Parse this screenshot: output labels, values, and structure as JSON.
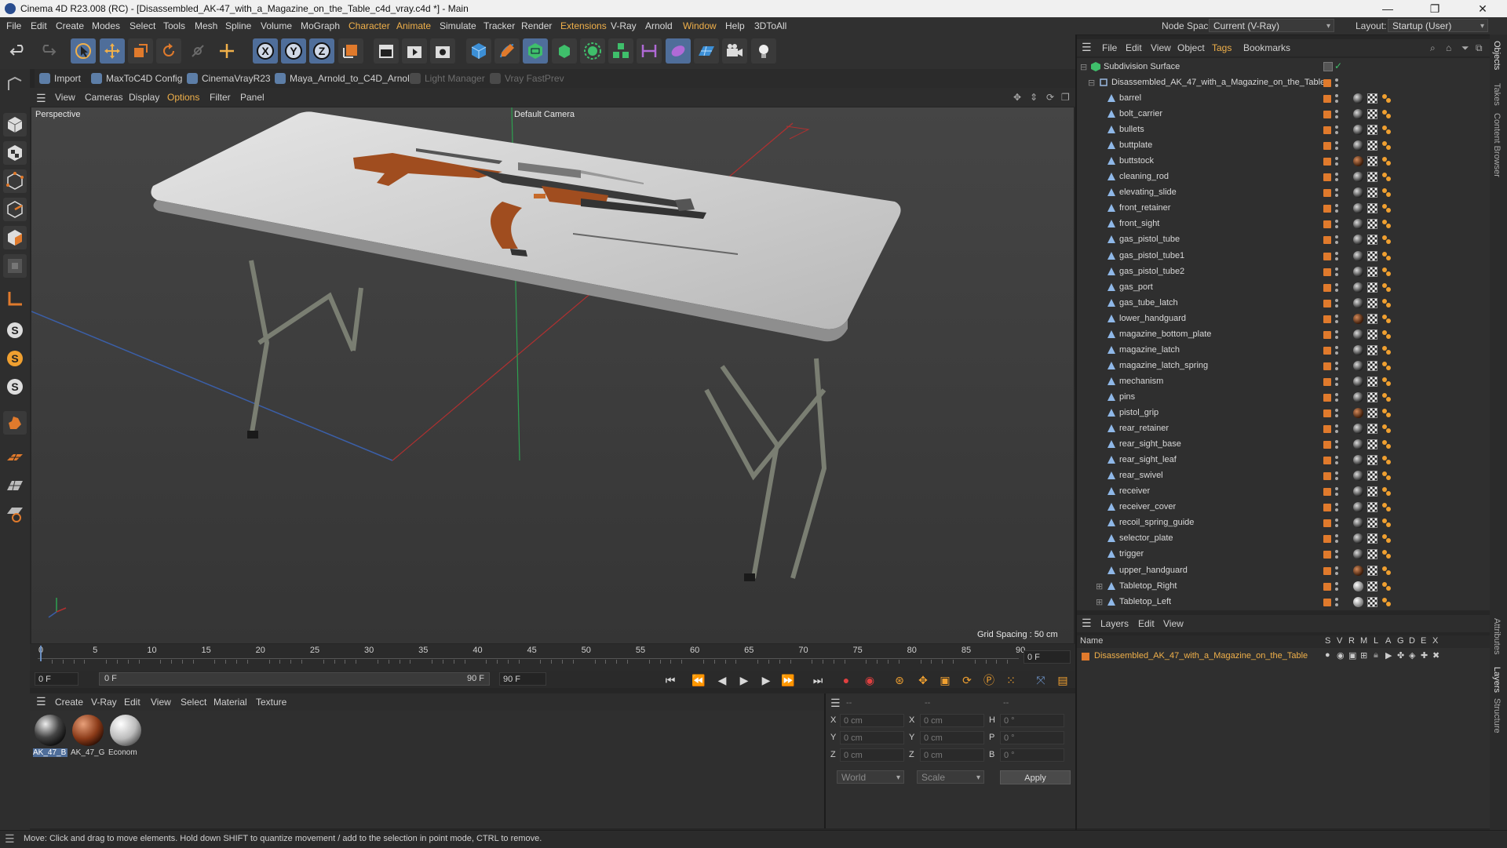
{
  "window": {
    "title": "Cinema 4D R23.008 (RC) - [Disassembled_AK-47_with_a_Magazine_on_the_Table_c4d_vray.c4d *] - Main",
    "minimize": "—",
    "restore": "❐",
    "close": "✕"
  },
  "menubar": {
    "items": [
      "File",
      "Edit",
      "Create",
      "Modes",
      "Select",
      "Tools",
      "Mesh",
      "Spline",
      "Volume",
      "MoGraph",
      "Character",
      "Animate",
      "Simulate",
      "Tracker",
      "Render",
      "Extensions",
      "V-Ray",
      "Arnold",
      "Window",
      "Help",
      "3DToAll"
    ],
    "node_space_label": "Node Space:",
    "node_space_value": "Current (V-Ray)",
    "layout_label": "Layout:",
    "layout_value": "Startup (User)"
  },
  "pluginbar": {
    "items": [
      "Import",
      "MaxToC4D Config",
      "CinemaVrayR23",
      "Maya_Arnold_to_C4D_Arnold",
      "Light Manager",
      "Vray FastPrev"
    ]
  },
  "viewport": {
    "menu": [
      "View",
      "Cameras",
      "Display",
      "Options",
      "Filter",
      "Panel"
    ],
    "label": "Perspective",
    "camera": "Default Camera",
    "grid_spacing": "Grid Spacing : 50 cm"
  },
  "timeline": {
    "ticks": [
      "0",
      "5",
      "10",
      "15",
      "20",
      "25",
      "30",
      "35",
      "40",
      "45",
      "50",
      "55",
      "60",
      "65",
      "70",
      "75",
      "80",
      "85",
      "90"
    ],
    "current_frame": "0 F",
    "start_field": "0 F",
    "range_start": "0 F",
    "range_end": "90 F",
    "end_field": "90 F"
  },
  "materials": {
    "menu": [
      "Create",
      "V-Ray",
      "Edit",
      "View",
      "Select",
      "Material",
      "Texture"
    ],
    "items": [
      {
        "label": "AK_47_B",
        "kind": "metal"
      },
      {
        "label": "AK_47_G",
        "kind": "wood"
      },
      {
        "label": "Econom",
        "kind": "plastic"
      }
    ]
  },
  "coords": {
    "header": [
      "--",
      "--",
      "--"
    ],
    "rows": [
      {
        "a": "X",
        "av": "0 cm",
        "b": "X",
        "bv": "0 cm",
        "c": "H",
        "cv": "0 °"
      },
      {
        "a": "Y",
        "av": "0 cm",
        "b": "Y",
        "bv": "0 cm",
        "c": "P",
        "cv": "0 °"
      },
      {
        "a": "Z",
        "av": "0 cm",
        "b": "Z",
        "bv": "0 cm",
        "c": "B",
        "cv": "0 °"
      }
    ],
    "space": "World",
    "mode": "Scale",
    "apply": "Apply"
  },
  "status": "Move: Click and drag to move elements. Hold down SHIFT to quantize movement / add to the selection in point mode, CTRL to remove.",
  "object_manager": {
    "menu": [
      "File",
      "Edit",
      "View",
      "Object",
      "Tags",
      "Bookmarks"
    ],
    "root": "Subdivision Surface",
    "group": "Disassembled_AK_47_with_a_Magazine_on_the_Table",
    "objects": [
      {
        "name": "barrel",
        "mat": "metal"
      },
      {
        "name": "bolt_carrier",
        "mat": "metal"
      },
      {
        "name": "bullets",
        "mat": "metal"
      },
      {
        "name": "buttplate",
        "mat": "metal"
      },
      {
        "name": "buttstock",
        "mat": "wood"
      },
      {
        "name": "cleaning_rod",
        "mat": "metal"
      },
      {
        "name": "elevating_slide",
        "mat": "metal"
      },
      {
        "name": "front_retainer",
        "mat": "metal"
      },
      {
        "name": "front_sight",
        "mat": "metal"
      },
      {
        "name": "gas_pistol_tube",
        "mat": "metal"
      },
      {
        "name": "gas_pistol_tube1",
        "mat": "metal"
      },
      {
        "name": "gas_pistol_tube2",
        "mat": "metal"
      },
      {
        "name": "gas_port",
        "mat": "metal"
      },
      {
        "name": "gas_tube_latch",
        "mat": "metal"
      },
      {
        "name": "lower_handguard",
        "mat": "wood"
      },
      {
        "name": "magazine_bottom_plate",
        "mat": "metal"
      },
      {
        "name": "magazine_latch",
        "mat": "metal"
      },
      {
        "name": "magazine_latch_spring",
        "mat": "metal"
      },
      {
        "name": "mechanism",
        "mat": "metal"
      },
      {
        "name": "pins",
        "mat": "metal"
      },
      {
        "name": "pistol_grip",
        "mat": "wood"
      },
      {
        "name": "rear_retainer",
        "mat": "metal"
      },
      {
        "name": "rear_sight_base",
        "mat": "metal"
      },
      {
        "name": "rear_sight_leaf",
        "mat": "metal"
      },
      {
        "name": "rear_swivel",
        "mat": "metal"
      },
      {
        "name": "receiver",
        "mat": "metal"
      },
      {
        "name": "receiver_cover",
        "mat": "metal"
      },
      {
        "name": "recoil_spring_guide",
        "mat": "metal"
      },
      {
        "name": "selector_plate",
        "mat": "metal"
      },
      {
        "name": "trigger",
        "mat": "metal"
      },
      {
        "name": "upper_handguard",
        "mat": "wood"
      },
      {
        "name": "Tabletop_Right",
        "mat": "white"
      },
      {
        "name": "Tabletop_Left",
        "mat": "white"
      }
    ]
  },
  "layers": {
    "menu": [
      "Layers",
      "Edit",
      "View"
    ],
    "columns": [
      "Name",
      "S",
      "V",
      "R",
      "M",
      "L",
      "A",
      "G",
      "D",
      "E",
      "X"
    ],
    "rows": [
      "Disassembled_AK_47_with_a_Magazine_on_the_Table"
    ]
  },
  "right_tabs": [
    "Objects",
    "Takes",
    "Content Browser",
    "Attributes",
    "Layers",
    "Structure"
  ],
  "colors": {
    "accent": "#f0b04a",
    "selection": "#4f6e9a",
    "layer_color": "#e07a2c"
  }
}
